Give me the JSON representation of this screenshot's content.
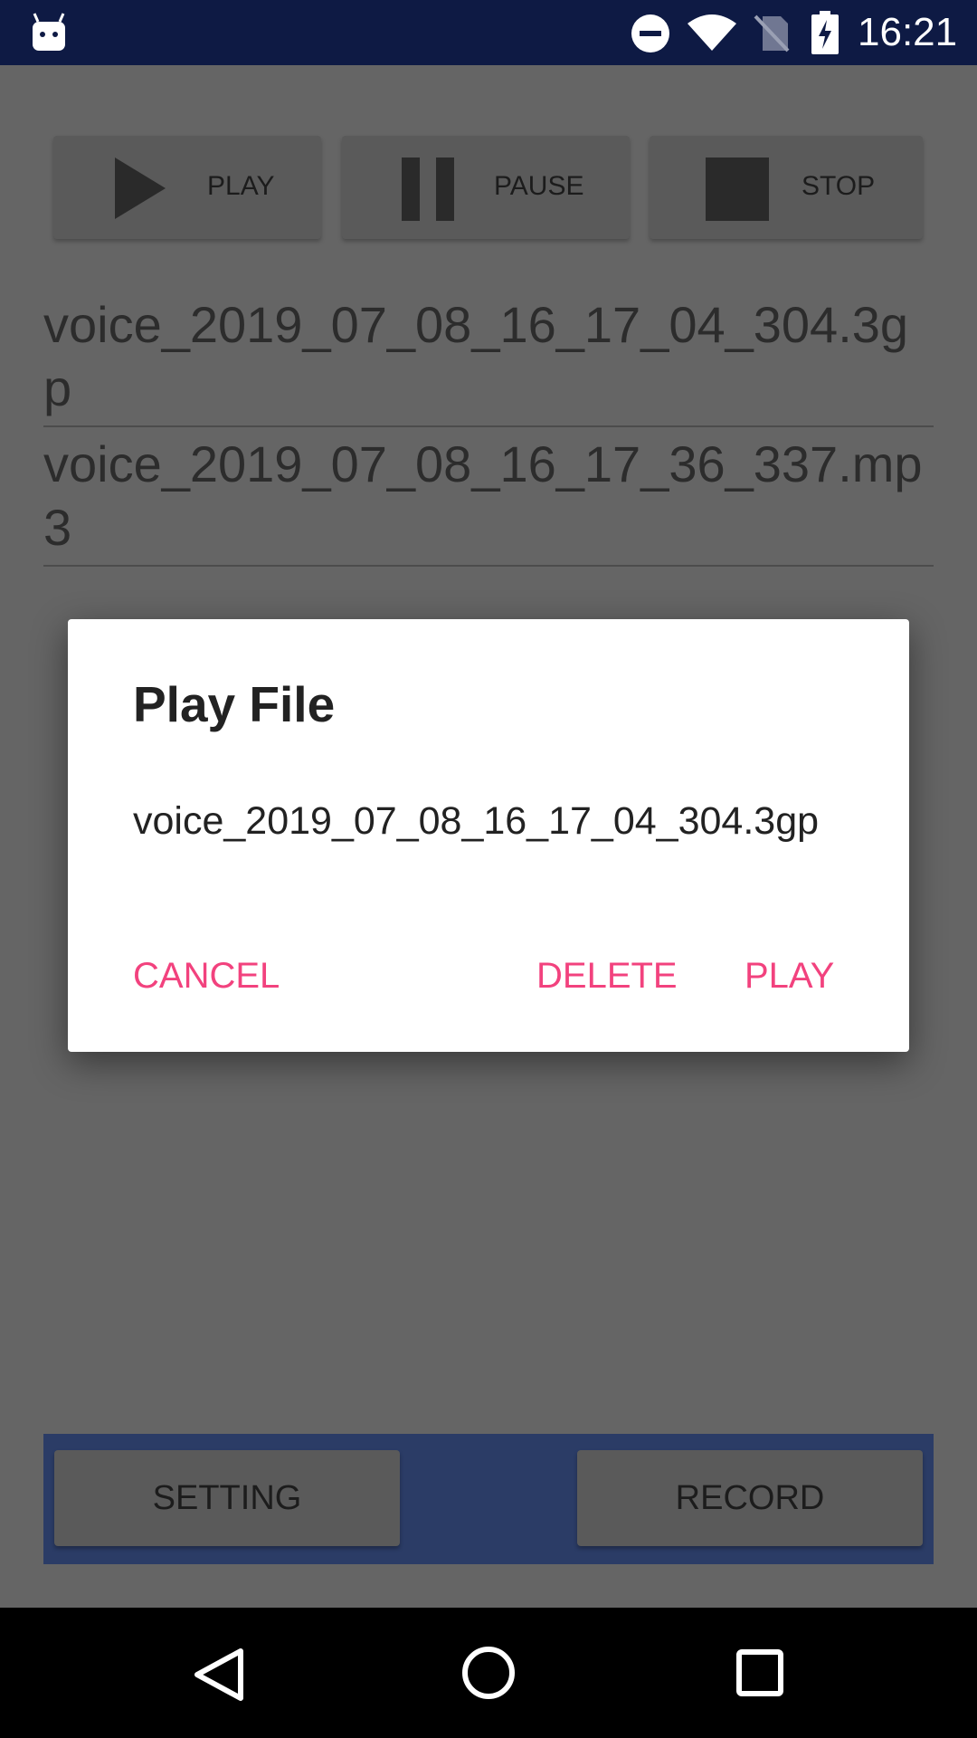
{
  "status_bar": {
    "time": "16:21",
    "icons": [
      "android-icon",
      "do-not-disturb-icon",
      "wifi-icon",
      "no-sim-icon",
      "battery-charging-icon"
    ]
  },
  "controls": {
    "play_label": "PLAY",
    "pause_label": "PAUSE",
    "stop_label": "STOP"
  },
  "files": [
    "voice_2019_07_08_16_17_04_304.3gp",
    "voice_2019_07_08_16_17_36_337.mp3"
  ],
  "bottom_panel": {
    "setting_label": "SETTING",
    "record_label": "RECORD"
  },
  "dialog": {
    "title": "Play File",
    "message": "voice_2019_07_08_16_17_04_304.3gp",
    "cancel_label": "CANCEL",
    "delete_label": "DELETE",
    "play_label": "PLAY"
  },
  "nav_bar": {
    "icons": [
      "back-icon",
      "home-icon",
      "recents-icon"
    ]
  },
  "colors": {
    "status_bar": "#0e1a44",
    "accent": "#f2427e",
    "panel": "#2b3c66",
    "scrim_background": "#656565"
  }
}
